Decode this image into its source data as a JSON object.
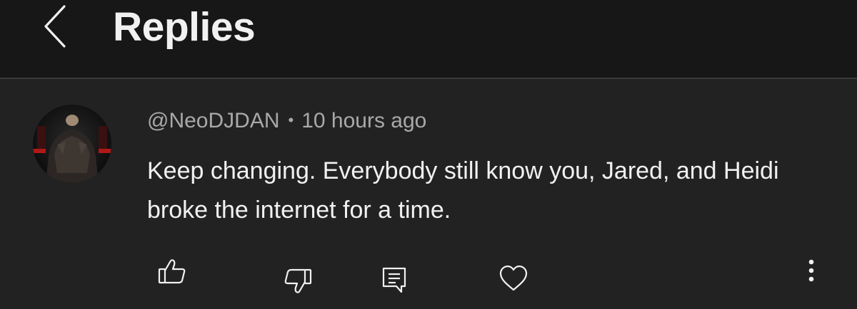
{
  "header": {
    "back_icon": "chevron-left-icon",
    "title": "Replies"
  },
  "comment": {
    "author": "@NeoDJDAN",
    "separator": "•",
    "timestamp": "10 hours ago",
    "text": "Keep changing. Everybody still know you, Jared, and Heidi broke the internet for a time."
  },
  "actions": {
    "like_icon": "thumbs-up-icon",
    "dislike_icon": "thumbs-down-icon",
    "reply_icon": "reply-comment-icon",
    "heart_icon": "heart-icon",
    "more_icon": "more-vertical-icon"
  },
  "colors": {
    "header_bg": "#171717",
    "body_bg": "#222222",
    "text_primary": "#f1f1f1",
    "text_secondary": "#a9a9a9"
  }
}
